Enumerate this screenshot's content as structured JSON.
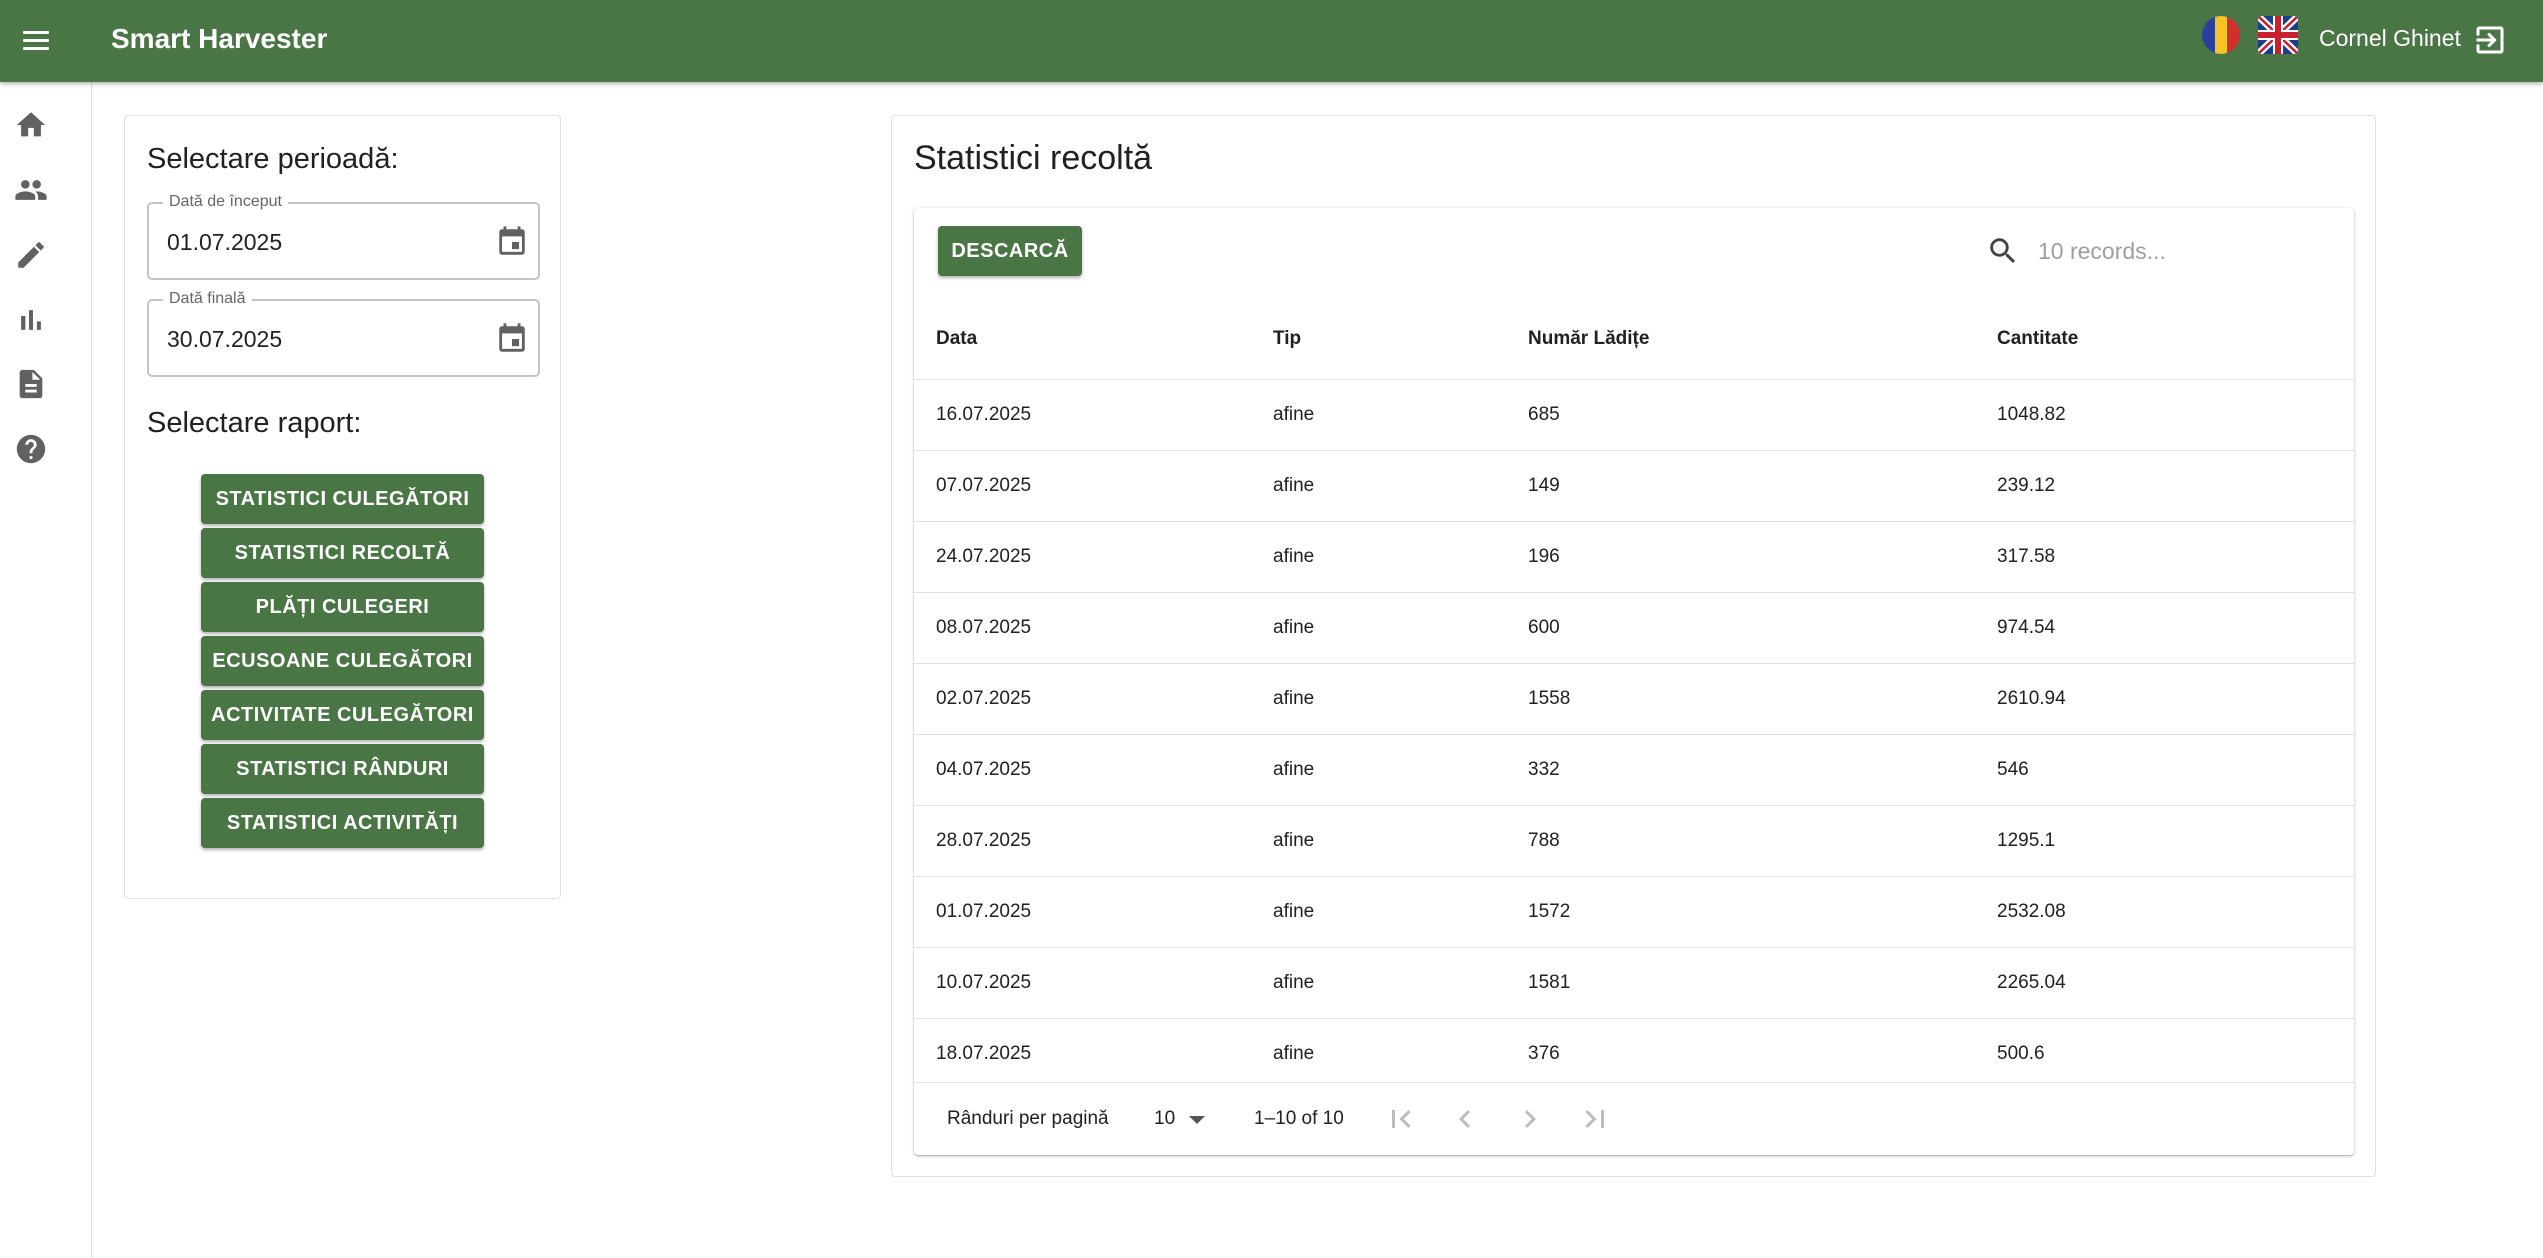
{
  "app": {
    "title": "Smart Harvester",
    "user_name": "Cornel Ghinet",
    "accent_color": "#4a7545"
  },
  "sidebar": {
    "icons": [
      "home-icon",
      "people-icon",
      "edit-icon",
      "bar-chart-icon",
      "document-icon",
      "help-icon"
    ]
  },
  "period": {
    "heading": "Selectare perioadă:",
    "start_label": "Dată de început",
    "start_value": "01.07.2025",
    "end_label": "Dată finală",
    "end_value": "30.07.2025"
  },
  "report": {
    "heading": "Selectare raport:",
    "buttons": [
      "STATISTICI CULEGĂTORI",
      "STATISTICI RECOLTĂ",
      "PLĂȚI CULEGERI",
      "ECUSOANE CULEGĂTORI",
      "ACTIVITATE CULEGĂTORI",
      "STATISTICI RÂNDURI",
      "STATISTICI ACTIVITĂȚI"
    ]
  },
  "main": {
    "title": "Statistici recoltă",
    "download_label": "DESCARCĂ",
    "search_placeholder": "10 records...",
    "columns": [
      "Data",
      "Tip",
      "Număr Lădițe",
      "Cantitate"
    ],
    "rows": [
      [
        "16.07.2025",
        "afine",
        "685",
        "1048.82"
      ],
      [
        "07.07.2025",
        "afine",
        "149",
        "239.12"
      ],
      [
        "24.07.2025",
        "afine",
        "196",
        "317.58"
      ],
      [
        "08.07.2025",
        "afine",
        "600",
        "974.54"
      ],
      [
        "02.07.2025",
        "afine",
        "1558",
        "2610.94"
      ],
      [
        "04.07.2025",
        "afine",
        "332",
        "546"
      ],
      [
        "28.07.2025",
        "afine",
        "788",
        "1295.1"
      ],
      [
        "01.07.2025",
        "afine",
        "1572",
        "2532.08"
      ],
      [
        "10.07.2025",
        "afine",
        "1581",
        "2265.04"
      ],
      [
        "18.07.2025",
        "afine",
        "376",
        "500.6"
      ]
    ],
    "pagination": {
      "rows_per_page_label": "Rânduri per pagină",
      "rows_per_page": "10",
      "range": "1–10 of 10"
    }
  }
}
